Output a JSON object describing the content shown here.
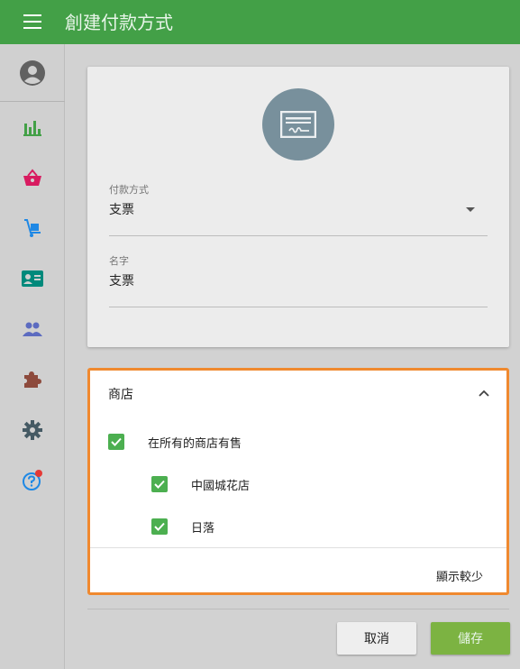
{
  "appbar": {
    "title": "創建付款方式"
  },
  "sidebar": {
    "items": [
      {
        "icon": "bar-chart-icon",
        "color": "#43a047"
      },
      {
        "icon": "basket-icon",
        "color": "#d81b60"
      },
      {
        "icon": "hand-truck-icon",
        "color": "#1e88e5"
      },
      {
        "icon": "contact-card-icon",
        "color": "#00897b"
      },
      {
        "icon": "people-icon",
        "color": "#5c6bc0"
      },
      {
        "icon": "puzzle-icon",
        "color": "#8d4a3c"
      },
      {
        "icon": "gear-icon",
        "color": "#455a64"
      },
      {
        "icon": "help-icon",
        "color": "#1e88e5",
        "badge_color": "#e53935"
      }
    ]
  },
  "form": {
    "payment_method": {
      "label": "付款方式",
      "value": "支票"
    },
    "name": {
      "label": "名字",
      "value": "支票"
    }
  },
  "stores": {
    "title": "商店",
    "all_stores": {
      "label": "在所有的商店有售",
      "checked": true
    },
    "items": [
      {
        "label": "中國城花店",
        "checked": true
      },
      {
        "label": "日落",
        "checked": true
      }
    ],
    "show_less": "顯示較少"
  },
  "actions": {
    "cancel": "取消",
    "save": "儲存"
  },
  "colors": {
    "accent": "#43a047",
    "highlight_border": "#f0892f",
    "checkbox": "#4caf50"
  }
}
